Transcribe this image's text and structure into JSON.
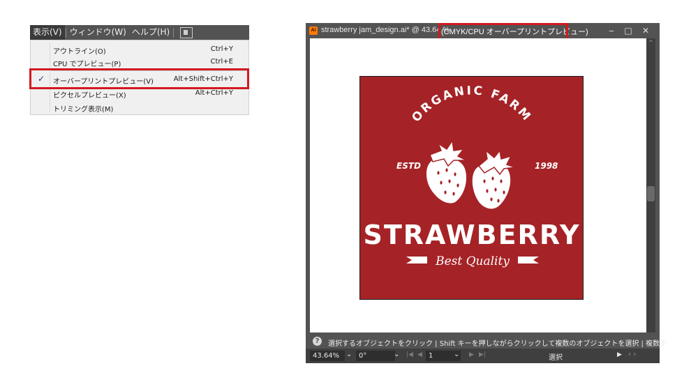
{
  "menubar": {
    "items": [
      {
        "label": "表示(V)",
        "active": true
      },
      {
        "label": "ウィンドウ(W)",
        "active": false
      },
      {
        "label": "ヘルプ(H)",
        "active": false
      }
    ],
    "icon": "hand-tool-icon"
  },
  "view_menu": {
    "items": [
      {
        "label": "アウトライン(O)",
        "shortcut": "Ctrl+Y",
        "checked": false
      },
      {
        "label": "CPU でプレビュー(P)",
        "shortcut": "Ctrl+E",
        "checked": false
      },
      {
        "label": "オーバープリントプレビュー(V)",
        "shortcut": "Alt+Shift+Ctrl+Y",
        "checked": true
      },
      {
        "label": "ピクセルプレビュー(X)",
        "shortcut": "Alt+Ctrl+Y",
        "checked": false
      },
      {
        "label": "トリミング表示(M)",
        "shortcut": "",
        "checked": false
      }
    ],
    "check_mark": "✓"
  },
  "document_window": {
    "app_icon": "Ai",
    "title": "strawberry jam_design.ai* @ 43.64 %",
    "mode": "(CMYK/CPU オーバープリントプレビュー)",
    "buttons": {
      "minimize": "‒",
      "maximize": "□",
      "close": "✕"
    },
    "scroll_up": "^"
  },
  "artwork": {
    "top_arc_text": "ORGANIC FARM",
    "left_text": "ESTD",
    "right_text": "1998",
    "main_text": "STRAWBERRY",
    "tagline": "Best Quality",
    "background_color": "#a52327",
    "foreground_color": "#ffffff"
  },
  "status_bar": {
    "info_icon": "?",
    "hint": "選択するオブジェクトをクリック | Shift キーを押しながらクリックして複数のオブジェクトを選択 | 複数す"
  },
  "bottom_bar": {
    "zoom": "43.64%",
    "rotation": "0°",
    "artboard_number": "1",
    "current_tool": "選択",
    "chevron": "⌄",
    "nav_first": "|◀",
    "nav_prev": "◀",
    "nav_next": "▶",
    "nav_last": "▶|",
    "play": "▶",
    "arrows": "‹ ›"
  }
}
